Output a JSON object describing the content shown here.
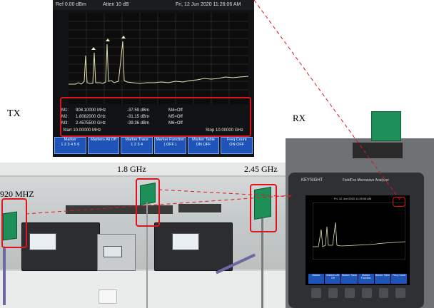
{
  "labels": {
    "tx": "TX",
    "rx": "RX",
    "f920": "920 MHZ",
    "f18": "1.8 GHz",
    "f245": "2.45 GHz"
  },
  "analyzer_top": {
    "ref": "Ref 0.00 dBm",
    "atten": "Atten 10 dB",
    "datetime": "Fri, 12 Jun 2020 11:26:06 AM",
    "markers": [
      {
        "id": "M1:",
        "freq": "908.10000 MHz",
        "level": "-37.59 dBm",
        "status": "M4=Off"
      },
      {
        "id": "M2:",
        "freq": "1.8082000 GHz",
        "level": "-31.15 dBm",
        "status": "M5=Off"
      },
      {
        "id": "M3:",
        "freq": "2.4575500 GHz",
        "level": "-39.36 dBm",
        "status": "M6=Off"
      }
    ],
    "start": "Start 10.00000 MHz",
    "stop": "Stop 10.00000 GHz",
    "softkeys": [
      {
        "line1": "Marker",
        "line2": "1 2 3 4 5 6"
      },
      {
        "line1": "Markers All Off",
        "line2": ""
      },
      {
        "line1": "Marker Trace",
        "line2": "1 2 3 4"
      },
      {
        "line1": "Marker Function",
        "line2": "( OFF )"
      },
      {
        "line1": "Marker Table",
        "line2": "ON OFF"
      },
      {
        "line1": "Freq Count",
        "line2": "ON OFF"
      }
    ]
  },
  "analyzer_rx": {
    "brand": "KEYSIGHT",
    "model": "FieldFox Microwave Analyzer",
    "datetime": "Fri, 12 Jun 2020 11:26:06 AM",
    "softkeys": [
      "Marker",
      "Markers All Off",
      "Marker Trace",
      "Marker Function",
      "Marker Table",
      "Freq Count"
    ]
  },
  "colors": {
    "annotation": "#e0141b",
    "antenna": "#1f8f5a",
    "softkey": "#1e54b8",
    "trace": "#e6e2b0"
  }
}
